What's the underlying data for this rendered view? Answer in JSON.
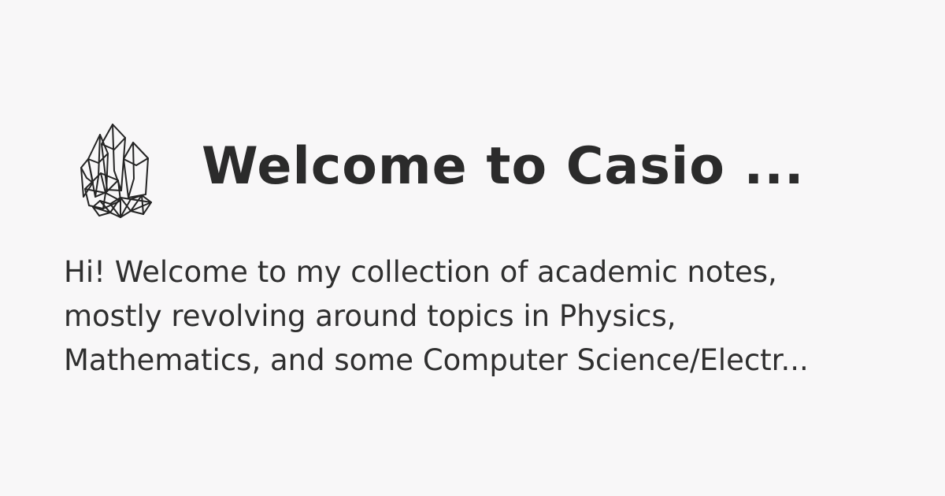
{
  "card": {
    "logo_icon": "crystal-cluster-icon",
    "title": "Welcome to Casio ...",
    "description_lines": [
      "Hi! Welcome to my collection of academic notes,",
      "mostly revolving around topics in Physics,",
      "Mathematics, and some Computer Science/Electr..."
    ]
  },
  "colors": {
    "background": "#f8f7f8",
    "text": "#2b2b2b"
  }
}
